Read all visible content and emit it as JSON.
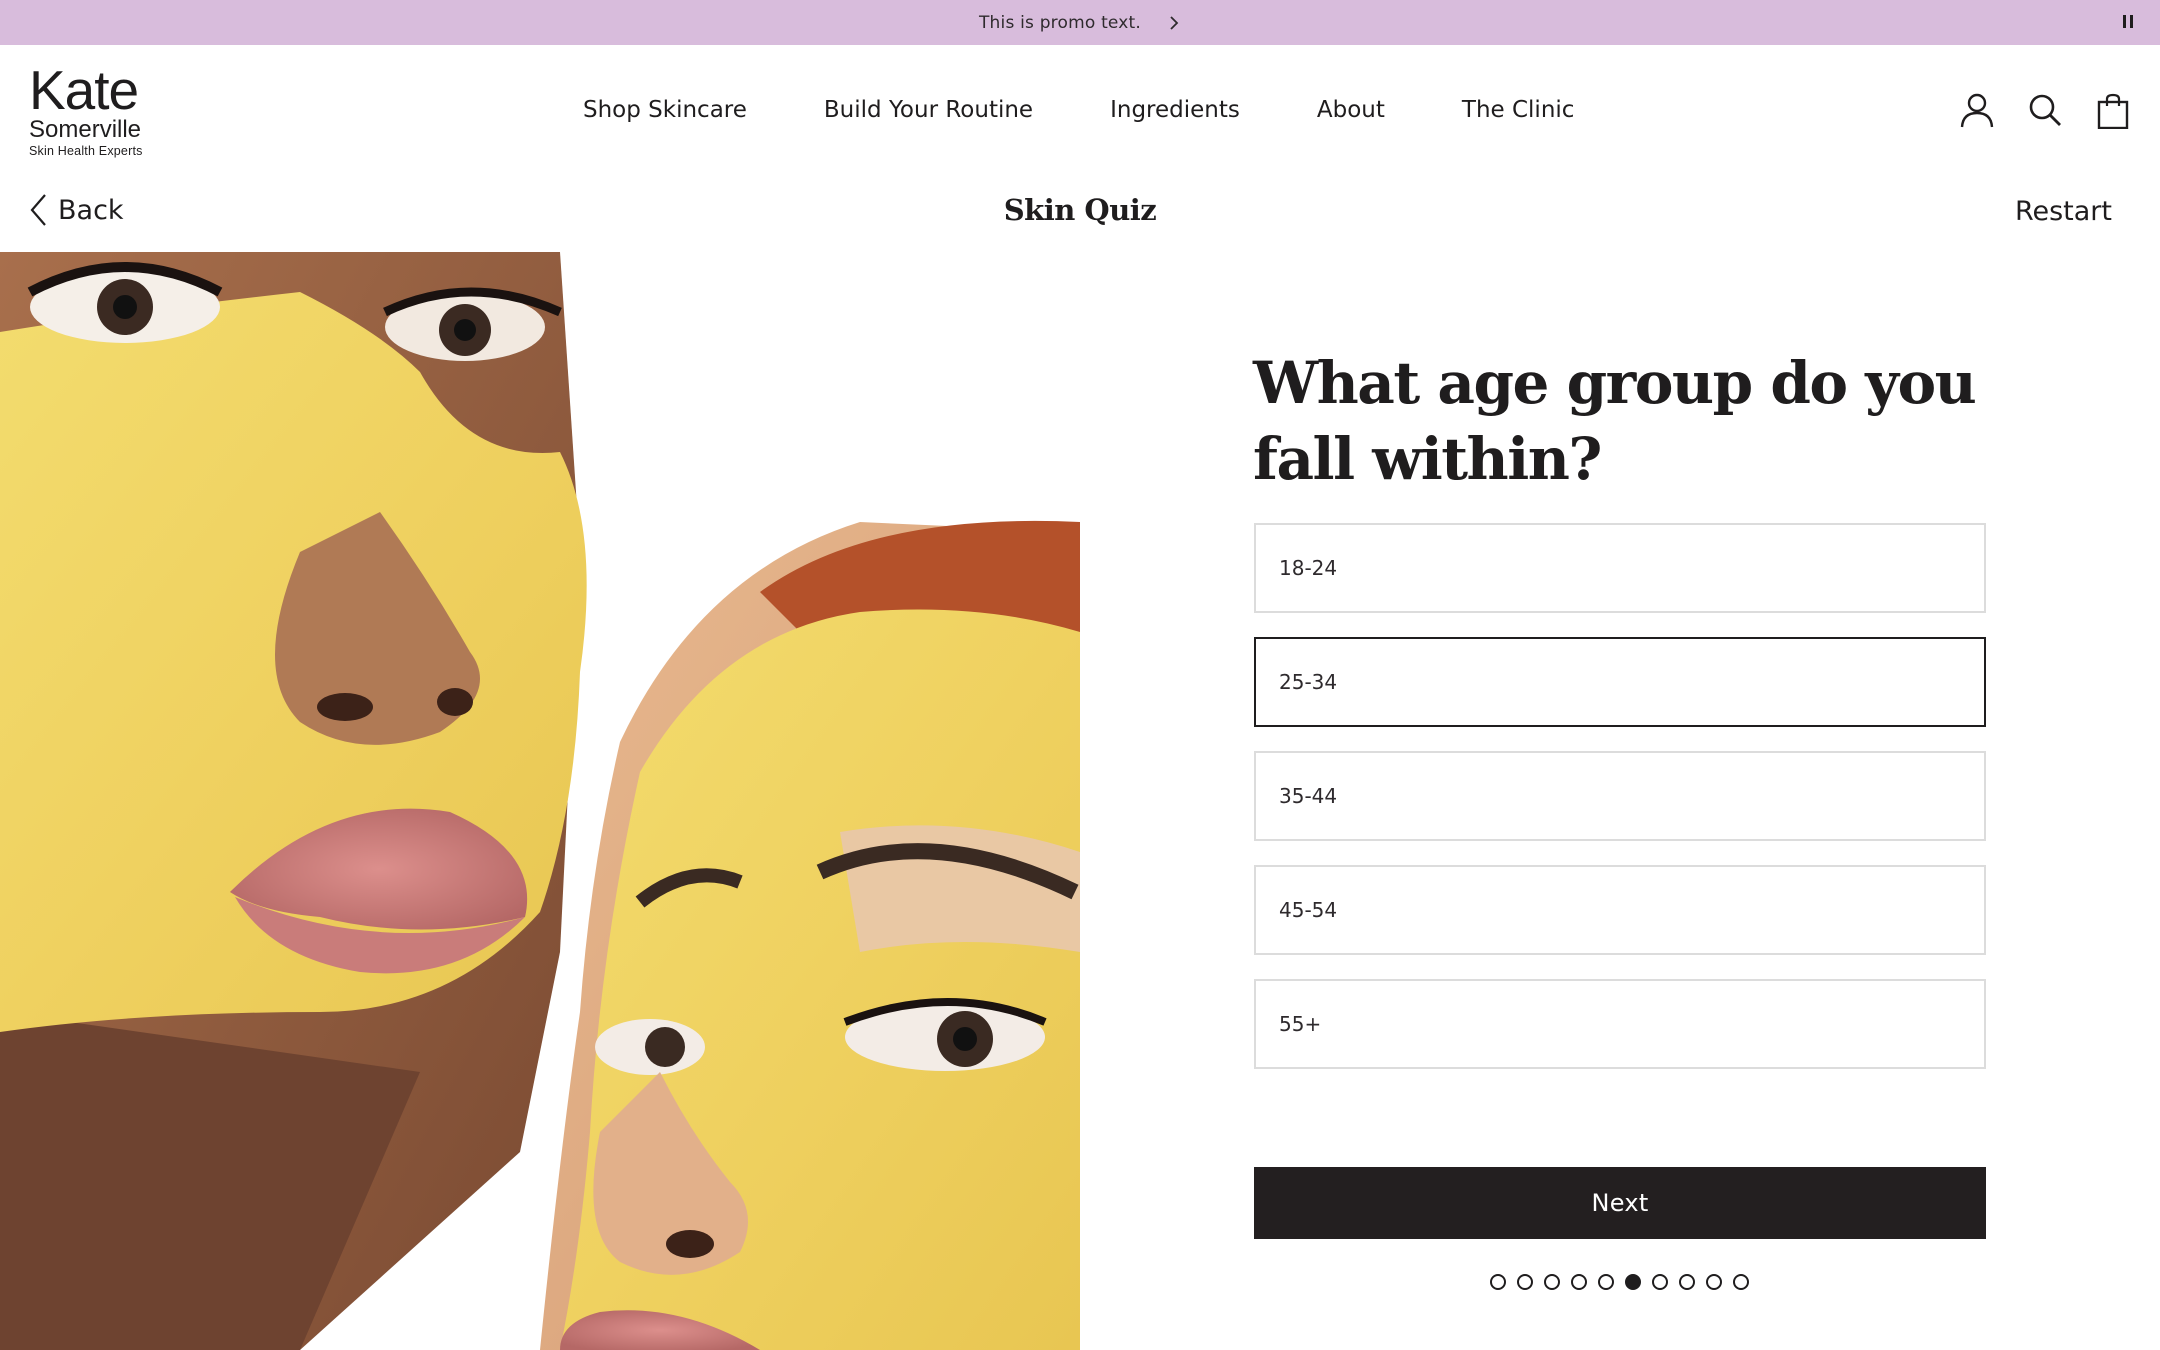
{
  "promo": {
    "text": "This is promo text.",
    "arrow_icon": "chevron-right-icon",
    "pause_icon": "pause-icon",
    "background": "#d8bcdc"
  },
  "logo": {
    "main": "Kate",
    "sub": "Somerville",
    "tagline": "Skin Health Experts"
  },
  "nav": {
    "items": [
      "Shop Skincare",
      "Build Your Routine",
      "Ingredients",
      "About",
      "The Clinic"
    ]
  },
  "header_icons": [
    "account-icon",
    "search-icon",
    "shopping-bag-icon"
  ],
  "subbar": {
    "back_label": "Back",
    "title": "Skin Quiz",
    "restart_label": "Restart"
  },
  "quiz": {
    "question": "What age group do you fall within?",
    "options": [
      "18-24",
      "25-34",
      "35-44",
      "45-54",
      "55+"
    ],
    "selected_option": "25-34",
    "next_label": "Next",
    "progress": {
      "total_steps": 10,
      "current_step": 6
    }
  },
  "colors": {
    "text": "#1f1d1e",
    "button": "#231f20",
    "option_border": "#dcdcdc"
  }
}
